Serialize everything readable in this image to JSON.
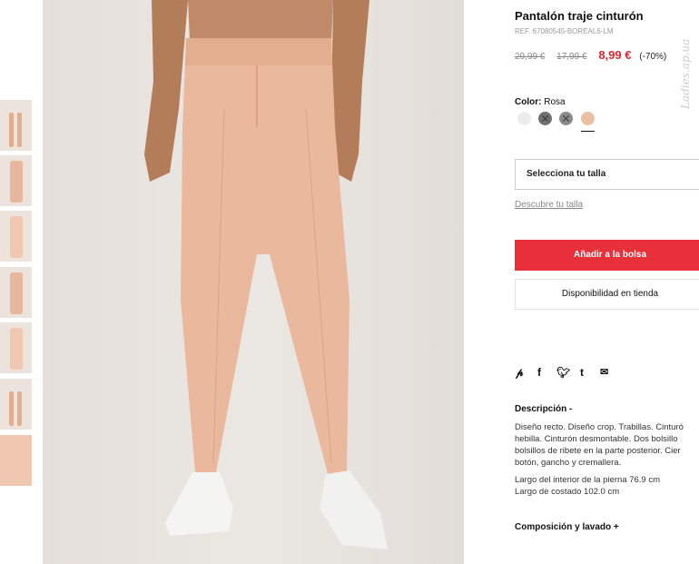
{
  "product": {
    "title": "Pantalón traje cinturón",
    "ref": "REF. 67080545-BOREAL6-LM",
    "price_original": "29,99 €",
    "price_previous": "17,99 €",
    "price_current": "8,99 €",
    "discount": "(-70%)",
    "color_label": "Color:",
    "color_value": "Rosa"
  },
  "swatches": [
    {
      "name": "white",
      "color": "#ececec",
      "unavailable": false
    },
    {
      "name": "grey-dark",
      "color": "#707070",
      "unavailable": true
    },
    {
      "name": "grey",
      "color": "#8a8a8a",
      "unavailable": true
    },
    {
      "name": "rosa",
      "color": "#e9c0a4",
      "unavailable": false,
      "selected": true
    }
  ],
  "size": {
    "select_label": "Selecciona tu talla",
    "discover_link": "Descubre tu talla"
  },
  "buttons": {
    "add_to_bag": "Añadir a la bolsa",
    "store_availability": "Disponibilidad en tienda"
  },
  "share_icons": [
    "pinterest-icon",
    "facebook-icon",
    "twitter-icon",
    "tumblr-icon",
    "email-icon"
  ],
  "description": {
    "title": "Descripción -",
    "lines_1": [
      "Diseño recto. Diseño crop. Trabillas. Cinturó",
      "hebilla. Cinturón desmontable. Dos bolsillo",
      "bolsillos de ribete en la parte posterior. Cier",
      "botón, gancho y cremallera."
    ],
    "lines_2": [
      "Largo del interior de la pierna 76.9 cm",
      "Largo de costado 102.0 cm"
    ]
  },
  "composition_title": "Composición y lavado +",
  "watermark": "Ladies.ap.ua",
  "colors": {
    "accent_red": "#e8303a",
    "price_red": "#e0262e",
    "pants": "#eab89c"
  }
}
